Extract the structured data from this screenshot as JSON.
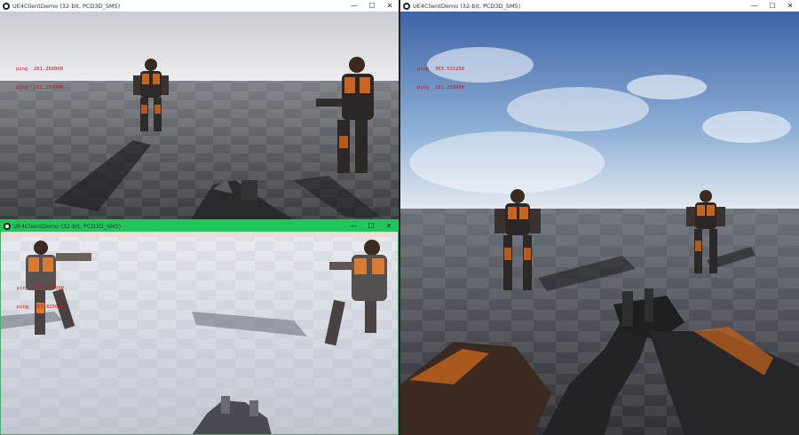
{
  "windows": [
    {
      "title": "UE4ClientDemo (32-bit, PCD3D_SM5)",
      "ping_lines": [
        "ping  281.250000",
        "ping  281.250000"
      ],
      "active": false
    },
    {
      "title": "UE4ClientDemo (32-bit, PCD3D_SM5)",
      "ping_lines": [
        "ping  303.531250",
        "ping  281.250000"
      ],
      "active": false
    },
    {
      "title": "UE4ClientDemo (32-bit, PCD3D_SM5)",
      "ping_lines": [
        "ping  281.150000",
        "ping  265.825000"
      ],
      "active": true,
      "accent": "#1ec75a"
    }
  ],
  "controls": {
    "minimize": "—",
    "maximize": "☐",
    "close": "✕"
  },
  "colors": {
    "ping_text": "#d01010",
    "active_titlebar": "#1ec75a",
    "armor_orange": "#c8641e"
  }
}
